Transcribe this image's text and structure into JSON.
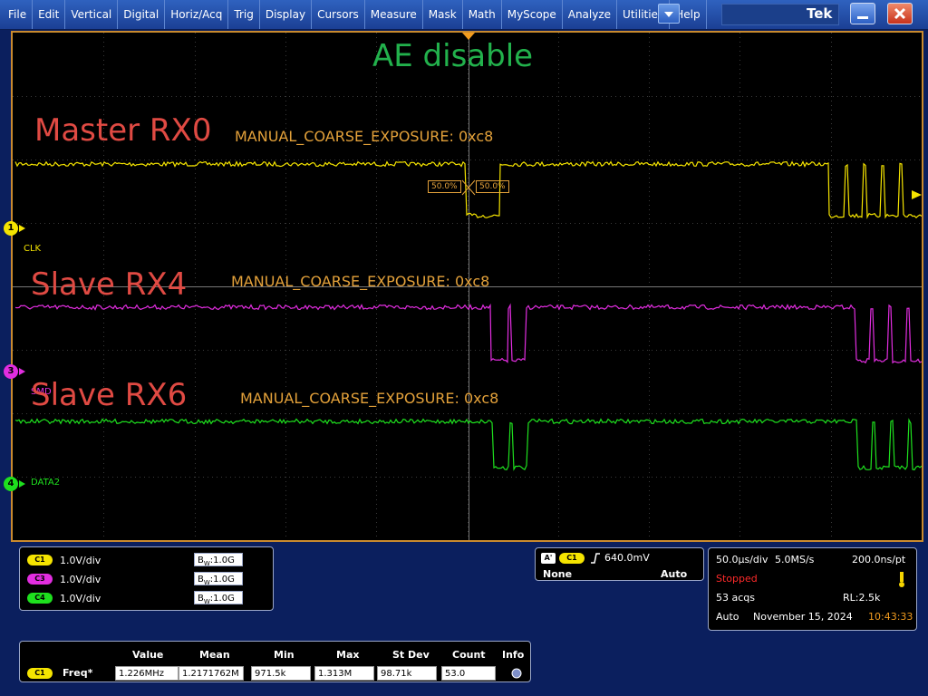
{
  "menu": {
    "items": [
      "File",
      "Edit",
      "Vertical",
      "Digital",
      "Horiz/Acq",
      "Trig",
      "Display",
      "Cursors",
      "Measure",
      "Mask",
      "Math",
      "MyScope",
      "Analyze",
      "Utilities",
      "Help"
    ],
    "dropdown_icon": "chevron-down-icon",
    "logo": "Tek",
    "minimize_icon": "minimize-icon",
    "close_icon": "close-icon"
  },
  "display": {
    "title": "AE disable",
    "trigger_threshold_left": "50.0%",
    "trigger_threshold_right": "50.0%",
    "channels": [
      {
        "number": "1",
        "label": "CLK",
        "color": "#f5e400",
        "name": "Master RX0",
        "annotation": "MANUAL_COARSE_EXPOSURE: 0xc8"
      },
      {
        "number": "3",
        "label": "SMD",
        "color": "#e22de0",
        "name": "Slave RX4",
        "annotation": "MANUAL_COARSE_EXPOSURE: 0xc8"
      },
      {
        "number": "4",
        "label": "DATA2",
        "color": "#1ee01e",
        "name": "Slave RX6",
        "annotation": "MANUAL_COARSE_EXPOSURE: 0xc8"
      }
    ]
  },
  "vertical": [
    {
      "badge": "C1",
      "badge_color": "#f5e400",
      "scale": "1.0V/div",
      "bw_label": "B",
      "bw_sub": "W",
      "bw_value": ":1.0G"
    },
    {
      "badge": "C3",
      "badge_color": "#e22de0",
      "scale": "1.0V/div",
      "bw_label": "B",
      "bw_sub": "W",
      "bw_value": ":1.0G"
    },
    {
      "badge": "C4",
      "badge_color": "#1ee01e",
      "scale": "1.0V/div",
      "bw_label": "B",
      "bw_sub": "W",
      "bw_value": ":1.0G"
    }
  ],
  "trigger": {
    "source_badge": "A'",
    "channel_badge": "C1",
    "slope_icon": "rising-edge-icon",
    "level": "640.0mV",
    "coupling": "None",
    "mode": "Auto"
  },
  "acquisition": {
    "timebase": "50.0µs/div",
    "sample_rate": "5.0MS/s",
    "resolution": "200.0ns/pt",
    "status": "Stopped",
    "acqs": "53 acqs",
    "record_length": "RL:2.5k",
    "mode": "Auto",
    "date": "November 15, 2024",
    "time": "10:43:33"
  },
  "measurements": {
    "headers": [
      "Value",
      "Mean",
      "Min",
      "Max",
      "St Dev",
      "Count",
      "Info"
    ],
    "row": {
      "badge": "C1",
      "name": "Freq*",
      "values": [
        "1.226MHz",
        "1.2171762M",
        "971.5k",
        "1.313M",
        "98.71k",
        "53.0"
      ],
      "info_icon": "info-icon"
    }
  }
}
